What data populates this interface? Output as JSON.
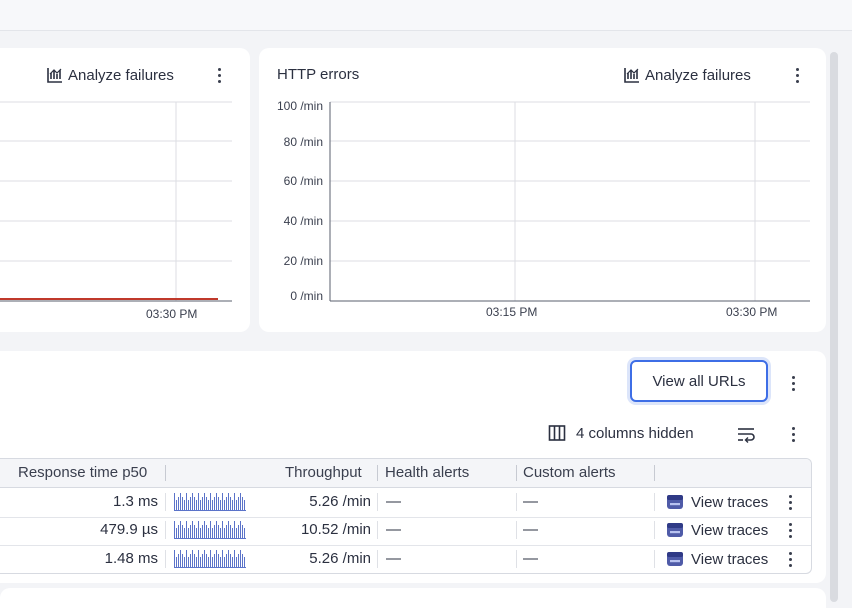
{
  "colors": {
    "accent": "#3e6ee6",
    "series_red": "#c0392b"
  },
  "left_card": {
    "analyze_label": "Analyze failures",
    "x_tick": "03:30 PM"
  },
  "http_errors": {
    "title": "HTTP errors",
    "analyze_label": "Analyze failures"
  },
  "chart_data": [
    {
      "type": "line",
      "title": "",
      "series": [
        {
          "values": [
            0,
            0,
            0,
            0,
            0
          ]
        }
      ],
      "xticks": [
        "03:30 PM"
      ],
      "grid": true
    },
    {
      "type": "line",
      "title": "HTTP errors",
      "yticks": [
        "100 /min",
        "80 /min",
        "60 /min",
        "40 /min",
        "20 /min",
        "0 /min"
      ],
      "ylim": [
        0,
        100
      ],
      "xticks": [
        "03:15 PM",
        "03:30 PM"
      ],
      "series": [],
      "grid": true
    }
  ],
  "urls_section": {
    "view_all_label": "View all URLs",
    "columns_hidden_label": "4 columns hidden"
  },
  "table": {
    "headers": [
      "Response time p50",
      "Throughput",
      "Health alerts",
      "Custom alerts"
    ],
    "rows": [
      {
        "response_time": "1.3 ms",
        "throughput": "5.26 /min",
        "health_alerts": "—",
        "custom_alerts": "—",
        "action": "View traces"
      },
      {
        "response_time": "479.9 µs",
        "throughput": "10.52 /min",
        "health_alerts": "—",
        "custom_alerts": "—",
        "action": "View traces"
      },
      {
        "response_time": "1.48 ms",
        "throughput": "5.26 /min",
        "health_alerts": "—",
        "custom_alerts": "—",
        "action": "View traces"
      }
    ]
  }
}
